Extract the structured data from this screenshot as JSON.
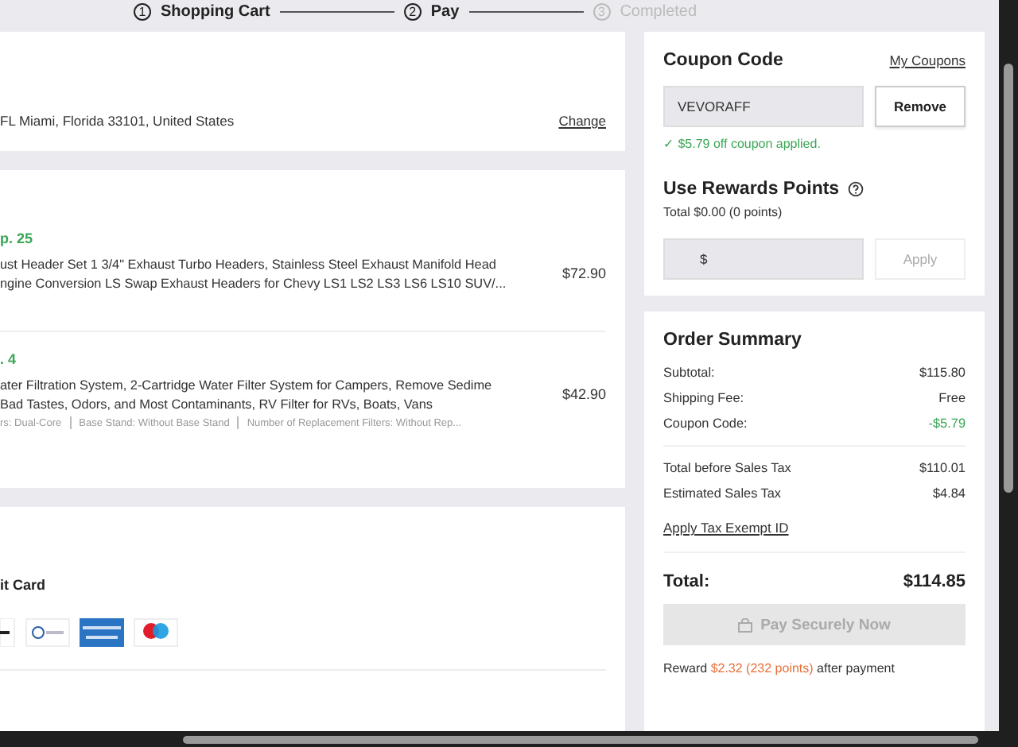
{
  "stepper": [
    {
      "number": "1",
      "label": "Shopping Cart",
      "disabled": false
    },
    {
      "number": "2",
      "label": "Pay",
      "disabled": false
    },
    {
      "number": "3",
      "label": "Completed",
      "disabled": true
    }
  ],
  "address": {
    "text": "FL Miami, Florida 33101, United States",
    "action": "Change"
  },
  "items": [
    {
      "shipping": "p. 25",
      "title_lines": [
        "ust Header Set 1 3/4\" Exhaust Turbo Headers, Stainless Steel Exhaust Manifold Head",
        "ngine Conversion LS Swap Exhaust Headers for Chevy LS1 LS2 LS3 LS6 LS10 SUV/..."
      ],
      "price": "$72.90"
    },
    {
      "shipping": ". 4",
      "title_lines": [
        "ater Filtration System, 2-Cartridge Water Filter System for Campers, Remove Sedime",
        " Bad Tastes, Odors, and Most Contaminants, RV Filter for RVs, Boats, Vans"
      ],
      "specs": [
        "rs: Dual-Core",
        "Base Stand: Without Base Stand",
        "Number of Replacement Filters: Without Rep..."
      ],
      "price": "$42.90"
    }
  ],
  "payment": {
    "method": "it Card",
    "logos": [
      {
        "kind": "partial"
      },
      {
        "kind": "diners"
      },
      {
        "kind": "amex"
      },
      {
        "kind": "maestro"
      }
    ]
  },
  "coupon": {
    "title": "Coupon Code",
    "link": "My Coupons",
    "value": "VEVORAFF",
    "button": "Remove",
    "message": "✓ $5.79 off coupon applied."
  },
  "rewards": {
    "title": "Use Rewards Points",
    "total": "Total $0.00 (0 points)",
    "prefix": "$",
    "button": "Apply",
    "button_disabled": true
  },
  "summary": {
    "title": "Order Summary",
    "groups": [
      [
        {
          "label": "Subtotal:",
          "value": "$115.80",
          "discount": false
        },
        {
          "label": "Shipping Fee:",
          "value": "Free",
          "discount": false
        },
        {
          "label": "Coupon Code:",
          "value": "-$5.79",
          "discount": true
        }
      ],
      [
        {
          "label": "Total before Sales Tax",
          "value": "$110.01",
          "discount": false
        },
        {
          "label": "Estimated Sales Tax",
          "value": "$4.84",
          "discount": false
        }
      ]
    ],
    "tax_link": "Apply Tax Exempt ID",
    "total_label": "Total:",
    "total_value": "$114.85",
    "pay_button": "Pay Securely Now",
    "pay_disabled": true,
    "reward_before": "Reward",
    "reward_amount": "$2.32 (232 points)",
    "reward_after": "after payment"
  }
}
